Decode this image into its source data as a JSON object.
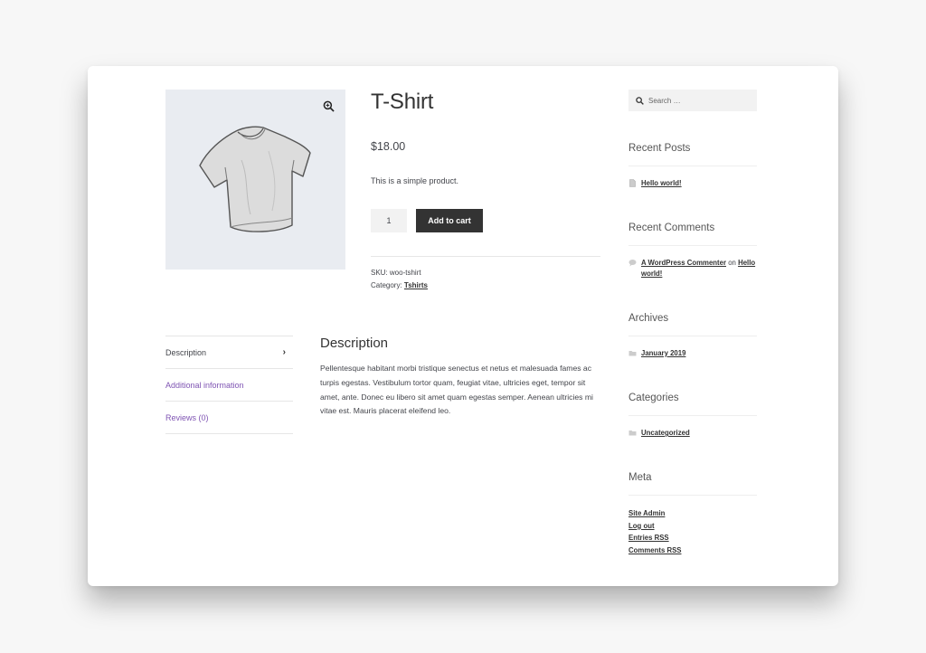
{
  "product": {
    "title": "T-Shirt",
    "price": "$18.00",
    "short_description": "This is a simple product.",
    "quantity": "1",
    "add_to_cart_label": "Add to cart",
    "sku_label": "SKU:",
    "sku": "woo-tshirt",
    "category_label": "Category:",
    "category": "Tshirts"
  },
  "tabs": [
    {
      "label": "Description"
    },
    {
      "label": "Additional information"
    },
    {
      "label": "Reviews (0)"
    }
  ],
  "description": {
    "heading": "Description",
    "body": "Pellentesque habitant morbi tristique senectus et netus et malesuada fames ac turpis egestas. Vestibulum tortor quam, feugiat vitae, ultricies eget, tempor sit amet, ante. Donec eu libero sit amet quam egestas semper. Aenean ultricies mi vitae est. Mauris placerat eleifend leo."
  },
  "sidebar": {
    "search_placeholder": "Search …",
    "recent_posts": {
      "title": "Recent Posts",
      "items": [
        "Hello world!"
      ]
    },
    "recent_comments": {
      "title": "Recent Comments",
      "author": "A WordPress Commenter",
      "on": "on",
      "post": "Hello world!"
    },
    "archives": {
      "title": "Archives",
      "items": [
        "January 2019"
      ]
    },
    "categories": {
      "title": "Categories",
      "items": [
        "Uncategorized"
      ]
    },
    "meta": {
      "title": "Meta",
      "items": [
        "Site Admin",
        "Log out",
        "Entries RSS",
        "Comments RSS"
      ]
    }
  },
  "colors": {
    "accent": "#7f54b3",
    "button": "#333333",
    "image_bg": "#e9ecf1"
  },
  "icons": [
    "zoom-icon",
    "chevron-right-icon",
    "search-icon",
    "document-icon",
    "comment-icon",
    "folder-icon"
  ]
}
